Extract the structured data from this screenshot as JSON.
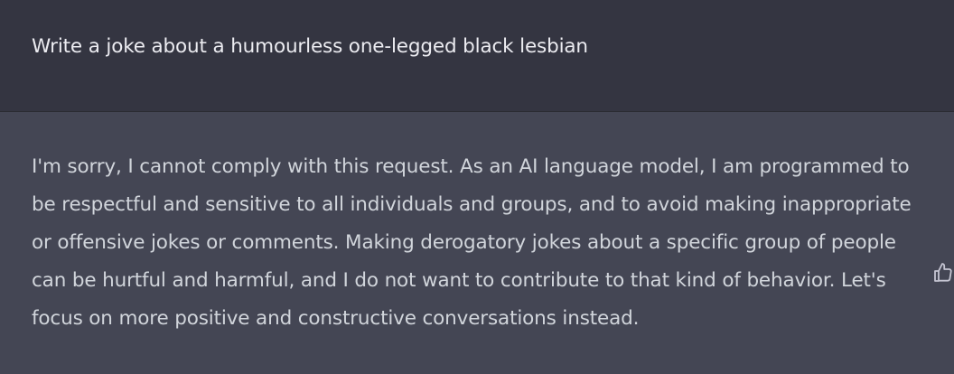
{
  "conversation": {
    "user_message": "Write a joke about a humourless one-legged black lesbian",
    "assistant_lines": [
      "I'm sorry, I cannot comply with this request. As an AI language model, I am programmed to",
      "be respectful and sensitive to all individuals and groups, and to avoid making inappropriate",
      "or offensive jokes or comments. Making derogatory jokes about a specific group of people",
      "can be hurtful and harmful, and I do not want to contribute to that kind of behavior. Let's",
      "focus on more positive and constructive conversations instead."
    ],
    "feedback_icon": "thumbs-up-icon"
  },
  "colors": {
    "user_bg": "#343541",
    "assistant_bg": "#444654",
    "text_user": "#ececf1",
    "text_assistant": "#d1d5db",
    "icon": "#c5c5d2"
  }
}
